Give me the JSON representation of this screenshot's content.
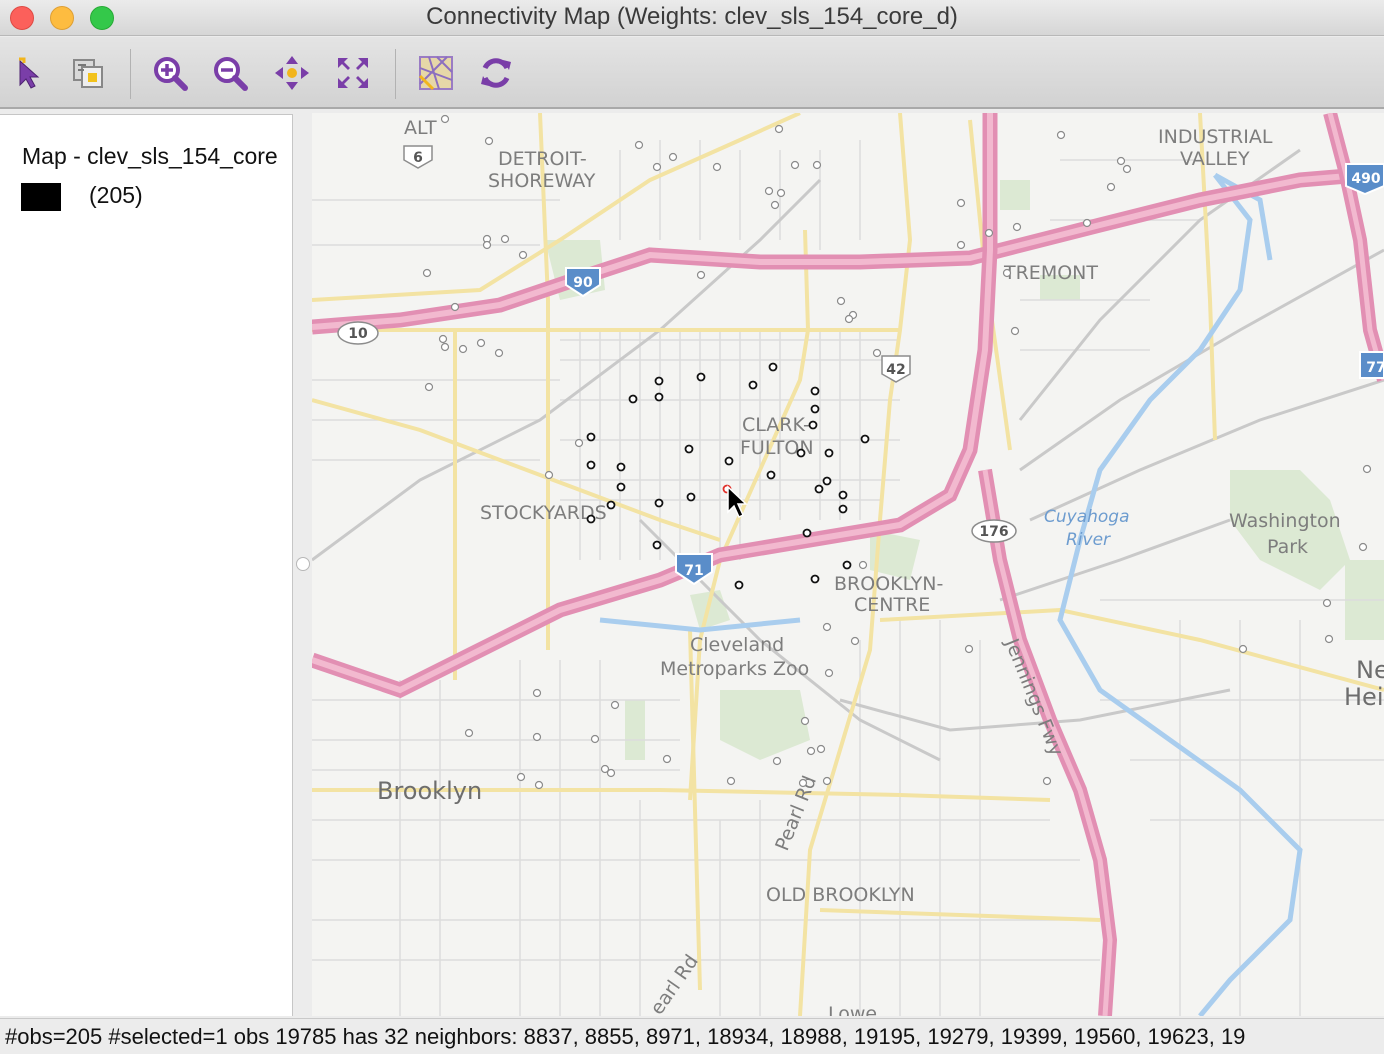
{
  "window": {
    "title": "Connectivity Map (Weights: clev_sls_154_core_d)"
  },
  "toolbar": {
    "tools": [
      {
        "name": "select-pointer-icon"
      },
      {
        "name": "select-mode-icon"
      },
      {
        "name": "zoom-in-icon"
      },
      {
        "name": "zoom-out-icon"
      },
      {
        "name": "pan-icon"
      },
      {
        "name": "full-extent-icon"
      },
      {
        "name": "basemap-icon"
      },
      {
        "name": "refresh-icon"
      }
    ]
  },
  "legend": {
    "title": "Map - clev_sls_154_core",
    "items": [
      {
        "color": "#000000",
        "count": "(205)"
      }
    ]
  },
  "map": {
    "labels": {
      "alt": "ALT",
      "route6": "6",
      "detroit": "DETROIT-",
      "shoreway": "SHOREWAY",
      "industrial": "INDUSTRIAL",
      "valley": "VALLEY",
      "i490": "490",
      "i90": "90",
      "route10": "10",
      "tremont": "TREMONT",
      "route42": "42",
      "clark": "CLARK-",
      "fulton": "FULTON",
      "stockyards": "STOCKYARDS",
      "i71": "71",
      "route176": "176",
      "cuyahoga": "Cuyahoga",
      "river": "River",
      "washington": "Washington",
      "park": "Park",
      "brooklyn_centre_1": "BROOKLYN-",
      "brooklyn_centre_2": "CENTRE",
      "zoo_1": "Cleveland",
      "zoo_2": "Metroparks Zoo",
      "jennings": "Jennings Fwy",
      "brooklyn": "Brooklyn",
      "pearl_rd": "Pearl Rd",
      "pearl_rd_2": "earl Rd",
      "old_brooklyn": "OLD BROOKLYN",
      "lowe": "Lowe",
      "route77": "77",
      "new_1": "New",
      "new_2": "Hei"
    },
    "neighbor_points": [
      [
        659,
        381
      ],
      [
        659,
        397
      ],
      [
        633,
        399
      ],
      [
        701,
        377
      ],
      [
        753,
        385
      ],
      [
        773,
        367
      ],
      [
        815,
        391
      ],
      [
        815,
        409
      ],
      [
        813,
        425
      ],
      [
        591,
        437
      ],
      [
        591,
        465
      ],
      [
        621,
        467
      ],
      [
        621,
        487
      ],
      [
        611,
        505
      ],
      [
        591,
        519
      ],
      [
        659,
        503
      ],
      [
        691,
        497
      ],
      [
        689,
        449
      ],
      [
        729,
        461
      ],
      [
        771,
        475
      ],
      [
        801,
        453
      ],
      [
        829,
        453
      ],
      [
        865,
        439
      ],
      [
        819,
        489
      ],
      [
        827,
        481
      ],
      [
        843,
        495
      ],
      [
        843,
        509
      ],
      [
        807,
        533
      ],
      [
        847,
        565
      ],
      [
        815,
        579
      ],
      [
        739,
        585
      ],
      [
        657,
        545
      ]
    ],
    "background_points": [
      [
        445,
        119
      ],
      [
        489,
        141
      ],
      [
        639,
        145
      ],
      [
        673,
        157
      ],
      [
        657,
        167
      ],
      [
        717,
        167
      ],
      [
        779,
        129
      ],
      [
        795,
        165
      ],
      [
        817,
        165
      ],
      [
        769,
        191
      ],
      [
        781,
        193
      ],
      [
        775,
        205
      ],
      [
        487,
        239
      ],
      [
        505,
        239
      ],
      [
        487,
        245
      ],
      [
        523,
        255
      ],
      [
        427,
        273
      ],
      [
        455,
        307
      ],
      [
        701,
        275
      ],
      [
        841,
        301
      ],
      [
        853,
        315
      ],
      [
        849,
        319
      ],
      [
        443,
        339
      ],
      [
        445,
        347
      ],
      [
        463,
        349
      ],
      [
        481,
        343
      ],
      [
        499,
        353
      ],
      [
        877,
        353
      ],
      [
        429,
        387
      ],
      [
        579,
        443
      ],
      [
        549,
        475
      ],
      [
        863,
        565
      ],
      [
        1061,
        135
      ],
      [
        1121,
        161
      ],
      [
        1127,
        169
      ],
      [
        1111,
        187
      ],
      [
        961,
        203
      ],
      [
        1017,
        227
      ],
      [
        1087,
        223
      ],
      [
        989,
        233
      ],
      [
        961,
        245
      ],
      [
        1007,
        273
      ],
      [
        1015,
        331
      ],
      [
        1367,
        469
      ],
      [
        1363,
        547
      ],
      [
        1327,
        603
      ],
      [
        1329,
        639
      ],
      [
        1243,
        649
      ],
      [
        969,
        649
      ],
      [
        855,
        641
      ],
      [
        827,
        627
      ],
      [
        829,
        673
      ],
      [
        1047,
        781
      ],
      [
        805,
        721
      ],
      [
        811,
        751
      ],
      [
        821,
        749
      ],
      [
        777,
        761
      ],
      [
        803,
        783
      ],
      [
        827,
        781
      ],
      [
        731,
        781
      ],
      [
        667,
        759
      ],
      [
        611,
        773
      ],
      [
        605,
        769
      ],
      [
        595,
        739
      ],
      [
        615,
        705
      ],
      [
        537,
        693
      ],
      [
        537,
        737
      ],
      [
        469,
        733
      ],
      [
        521,
        777
      ],
      [
        539,
        785
      ]
    ],
    "selected_point": [
      727,
      489
    ]
  },
  "status": {
    "text": "#obs=205 #selected=1  obs 19785 has 32 neighbors: 8837, 8855, 8971, 18934, 18988, 19195, 19279, 19399, 19560, 19623, 19"
  },
  "colors": {
    "highway": "#e28fb3",
    "highway_core": "#f0b1ca",
    "road_major": "#f5e6a6",
    "water": "#a9cdee",
    "park": "#dbe8d2",
    "point_selected": "#e0302a",
    "accent_purple": "#7a3ea8"
  }
}
